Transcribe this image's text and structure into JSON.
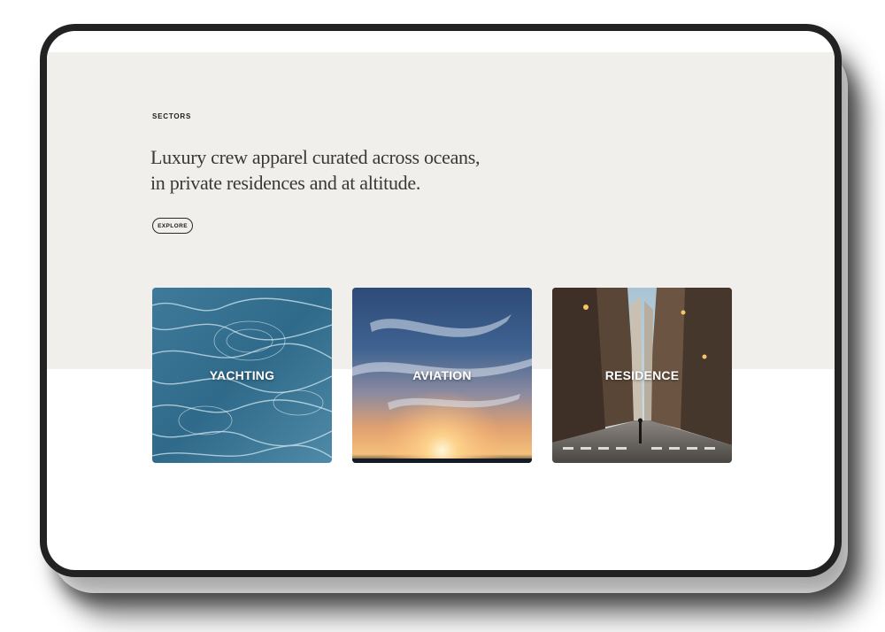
{
  "section": {
    "eyebrow": "SECTORS",
    "headline_line1": "Luxury crew apparel curated across oceans,",
    "headline_line2": "in private residences and at altitude.",
    "explore_label": "EXPLORE"
  },
  "cards": [
    {
      "label": "YACHTING",
      "image": "water-surface"
    },
    {
      "label": "AVIATION",
      "image": "sunset-sky"
    },
    {
      "label": "RESIDENCE",
      "image": "city-street"
    }
  ],
  "colors": {
    "section_bg": "#f0efeb",
    "page_bg": "#ffffff",
    "text": "#1c1c1c",
    "headline": "#3a3836",
    "device_frame": "#222222"
  }
}
